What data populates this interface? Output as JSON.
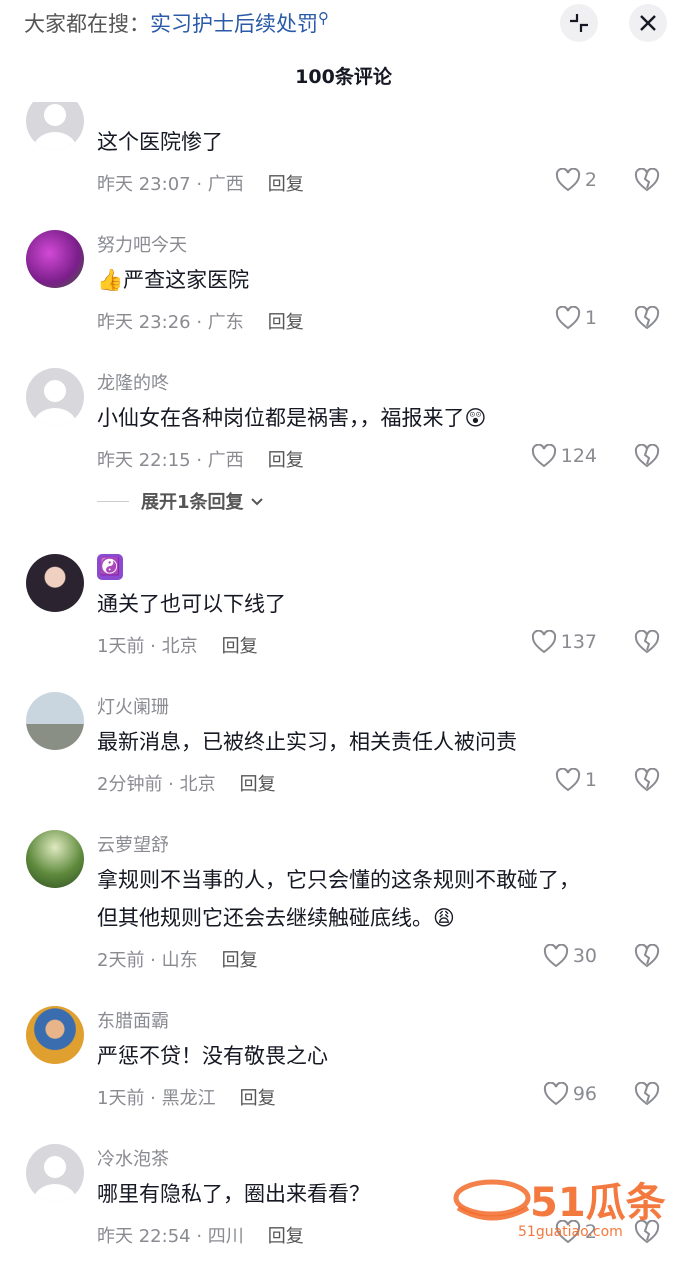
{
  "header": {
    "search_prefix": "大家都在搜：",
    "search_term": "实习护士后续处罚",
    "comment_count": "100条评论"
  },
  "comments": [
    {
      "username": "",
      "text": "这个医院惨了",
      "time": "昨天 23:07 · 广西",
      "reply": "回复",
      "likes": "2"
    },
    {
      "username": "努力吧今天",
      "text": "👍严查这家医院",
      "time": "昨天 23:26 · 广东",
      "reply": "回复",
      "likes": "1"
    },
    {
      "username": "龙隆的咚",
      "text": "小仙女在各种岗位都是祸害，，福报来了😲",
      "time": "昨天 22:15 · 广西",
      "reply": "回复",
      "likes": "124"
    },
    {
      "username": "☯️",
      "text": "通关了也可以下线了",
      "time": "1天前 · 北京",
      "reply": "回复",
      "likes": "137"
    },
    {
      "username": "灯火阑珊",
      "text": "最新消息，已被终止实习，相关责任人被问责",
      "time": "2分钟前 · 北京",
      "reply": "回复",
      "likes": "1"
    },
    {
      "username": "云萝望舒",
      "text": "拿规则不当事的人，它只会懂的这条规则不敢碰了，",
      "text2": "但其他规则它还会去继续触碰底线。😩",
      "time": "2天前 · 山东",
      "reply": "回复",
      "likes": "30"
    },
    {
      "username": "东腊面霸",
      "text": "严惩不贷！没有敬畏之心",
      "time": "1天前 · 黑龙江",
      "reply": "回复",
      "likes": "96"
    },
    {
      "username": "冷水泡茶",
      "text": "哪里有隐私了，圈出来看看？",
      "time": "昨天 22:54 · 四川",
      "reply": "回复",
      "likes": "2"
    }
  ],
  "expand_replies": "展开1条回复",
  "watermark": {
    "brand": "51瓜条",
    "url": "51guatiao.com"
  },
  "colors": {
    "accent_link": "#2a5aa8",
    "muted": "#8a8b91",
    "watermark": "#f26b2a"
  }
}
